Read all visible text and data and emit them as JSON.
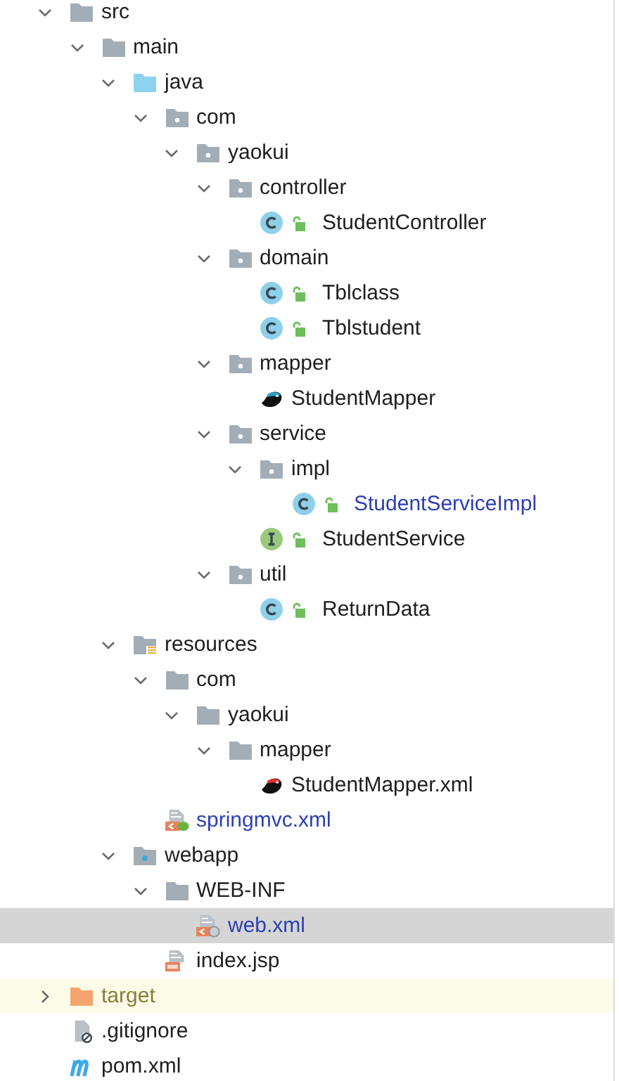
{
  "tree": [
    {
      "name": "src",
      "kind": "folder",
      "expanded": true,
      "selected": false,
      "modified": false,
      "children": [
        {
          "name": "main",
          "kind": "folder",
          "expanded": true,
          "selected": false,
          "modified": false,
          "children": [
            {
              "name": "java",
              "kind": "source-folder",
              "expanded": true,
              "selected": false,
              "modified": false,
              "children": [
                {
                  "name": "com",
                  "kind": "package",
                  "expanded": true,
                  "selected": false,
                  "modified": false,
                  "children": [
                    {
                      "name": "yaokui",
                      "kind": "package",
                      "expanded": true,
                      "selected": false,
                      "modified": false,
                      "children": [
                        {
                          "name": "controller",
                          "kind": "package",
                          "expanded": true,
                          "selected": false,
                          "modified": false,
                          "children": [
                            {
                              "name": "StudentController",
                              "kind": "class",
                              "public": true,
                              "selected": false,
                              "modified": false
                            }
                          ]
                        },
                        {
                          "name": "domain",
                          "kind": "package",
                          "expanded": true,
                          "selected": false,
                          "modified": false,
                          "children": [
                            {
                              "name": "Tblclass",
                              "kind": "class",
                              "public": true,
                              "selected": false,
                              "modified": false
                            },
                            {
                              "name": "Tblstudent",
                              "kind": "class",
                              "public": true,
                              "selected": false,
                              "modified": false
                            }
                          ]
                        },
                        {
                          "name": "mapper",
                          "kind": "package",
                          "expanded": true,
                          "selected": false,
                          "modified": false,
                          "children": [
                            {
                              "name": "StudentMapper",
                              "kind": "mapper",
                              "selected": false,
                              "modified": false
                            }
                          ]
                        },
                        {
                          "name": "service",
                          "kind": "package",
                          "expanded": true,
                          "selected": false,
                          "modified": false,
                          "children": [
                            {
                              "name": "impl",
                              "kind": "package",
                              "expanded": true,
                              "selected": false,
                              "modified": false,
                              "children": [
                                {
                                  "name": "StudentServiceImpl",
                                  "kind": "class",
                                  "public": true,
                                  "selected": false,
                                  "modified": true
                                }
                              ]
                            },
                            {
                              "name": "StudentService",
                              "kind": "interface",
                              "public": true,
                              "selected": false,
                              "modified": false
                            }
                          ]
                        },
                        {
                          "name": "util",
                          "kind": "package",
                          "expanded": true,
                          "selected": false,
                          "modified": false,
                          "children": [
                            {
                              "name": "ReturnData",
                              "kind": "class",
                              "public": true,
                              "selected": false,
                              "modified": false
                            }
                          ]
                        }
                      ]
                    }
                  ]
                }
              ]
            },
            {
              "name": "resources",
              "kind": "resources-folder",
              "expanded": true,
              "selected": false,
              "modified": false,
              "children": [
                {
                  "name": "com",
                  "kind": "folder",
                  "expanded": true,
                  "selected": false,
                  "modified": false,
                  "children": [
                    {
                      "name": "yaokui",
                      "kind": "folder",
                      "expanded": true,
                      "selected": false,
                      "modified": false,
                      "children": [
                        {
                          "name": "mapper",
                          "kind": "folder",
                          "expanded": true,
                          "selected": false,
                          "modified": false,
                          "children": [
                            {
                              "name": "StudentMapper.xml",
                              "kind": "mapper-xml",
                              "selected": false,
                              "modified": false
                            }
                          ]
                        }
                      ]
                    }
                  ]
                },
                {
                  "name": "springmvc.xml",
                  "kind": "spring-xml",
                  "selected": false,
                  "modified": true
                }
              ]
            },
            {
              "name": "webapp",
              "kind": "web-folder",
              "expanded": true,
              "selected": false,
              "modified": false,
              "children": [
                {
                  "name": "WEB-INF",
                  "kind": "folder",
                  "expanded": true,
                  "selected": false,
                  "modified": false,
                  "children": [
                    {
                      "name": "web.xml",
                      "kind": "web-xml",
                      "selected": true,
                      "modified": true
                    }
                  ]
                },
                {
                  "name": "index.jsp",
                  "kind": "jsp",
                  "selected": false,
                  "modified": false
                }
              ]
            }
          ]
        }
      ]
    },
    {
      "name": "target",
      "kind": "excluded-folder",
      "expanded": false,
      "selected": false,
      "modified": false
    },
    {
      "name": ".gitignore",
      "kind": "ignore-file",
      "selected": false,
      "modified": false
    },
    {
      "name": "pom.xml",
      "kind": "maven",
      "selected": false,
      "modified": false
    }
  ]
}
